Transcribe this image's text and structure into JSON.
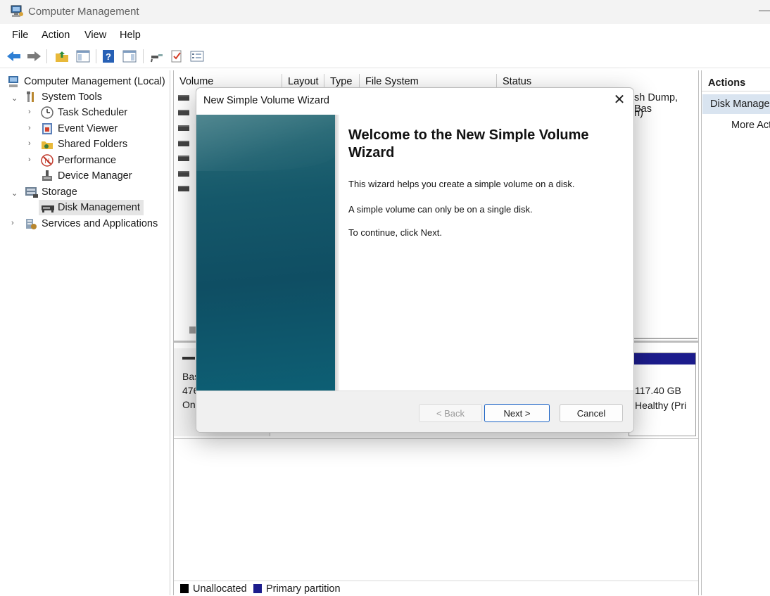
{
  "window": {
    "title": "Computer Management"
  },
  "menubar": {
    "items": [
      "File",
      "Action",
      "View",
      "Help"
    ]
  },
  "tree": {
    "root": "Computer Management (Local)",
    "system_tools": "System Tools",
    "task_scheduler": "Task Scheduler",
    "event_viewer": "Event Viewer",
    "shared_folders": "Shared Folders",
    "performance": "Performance",
    "device_manager": "Device Manager",
    "storage": "Storage",
    "disk_management": "Disk Management",
    "services": "Services and Applications"
  },
  "volume_list": {
    "columns": [
      "Volume",
      "Layout",
      "Type",
      "File System",
      "Status"
    ],
    "status_row_1": "sh Dump, Bas",
    "status_row_2": "n)",
    "row_prefix": "("
  },
  "disk": {
    "label_line1": "Bas",
    "label_line2": "476",
    "label_line3": "On",
    "partition_size": "117.40 GB",
    "partition_status": "Healthy (Pri"
  },
  "legend": {
    "unallocated": "Unallocated",
    "primary": "Primary partition",
    "unallocated_color": "#000000",
    "primary_color": "#1c1c8c"
  },
  "actions": {
    "header": "Actions",
    "section": "Disk Manage",
    "more": "More Act"
  },
  "dialog": {
    "title": "New Simple Volume Wizard",
    "heading": "Welcome to the New Simple Volume Wizard",
    "text1": "This wizard helps you create a simple volume on a disk.",
    "text2": "A simple volume can only be on a single disk.",
    "text3": "To continue, click Next.",
    "back": "< Back",
    "next": "Next >",
    "cancel": "Cancel"
  }
}
